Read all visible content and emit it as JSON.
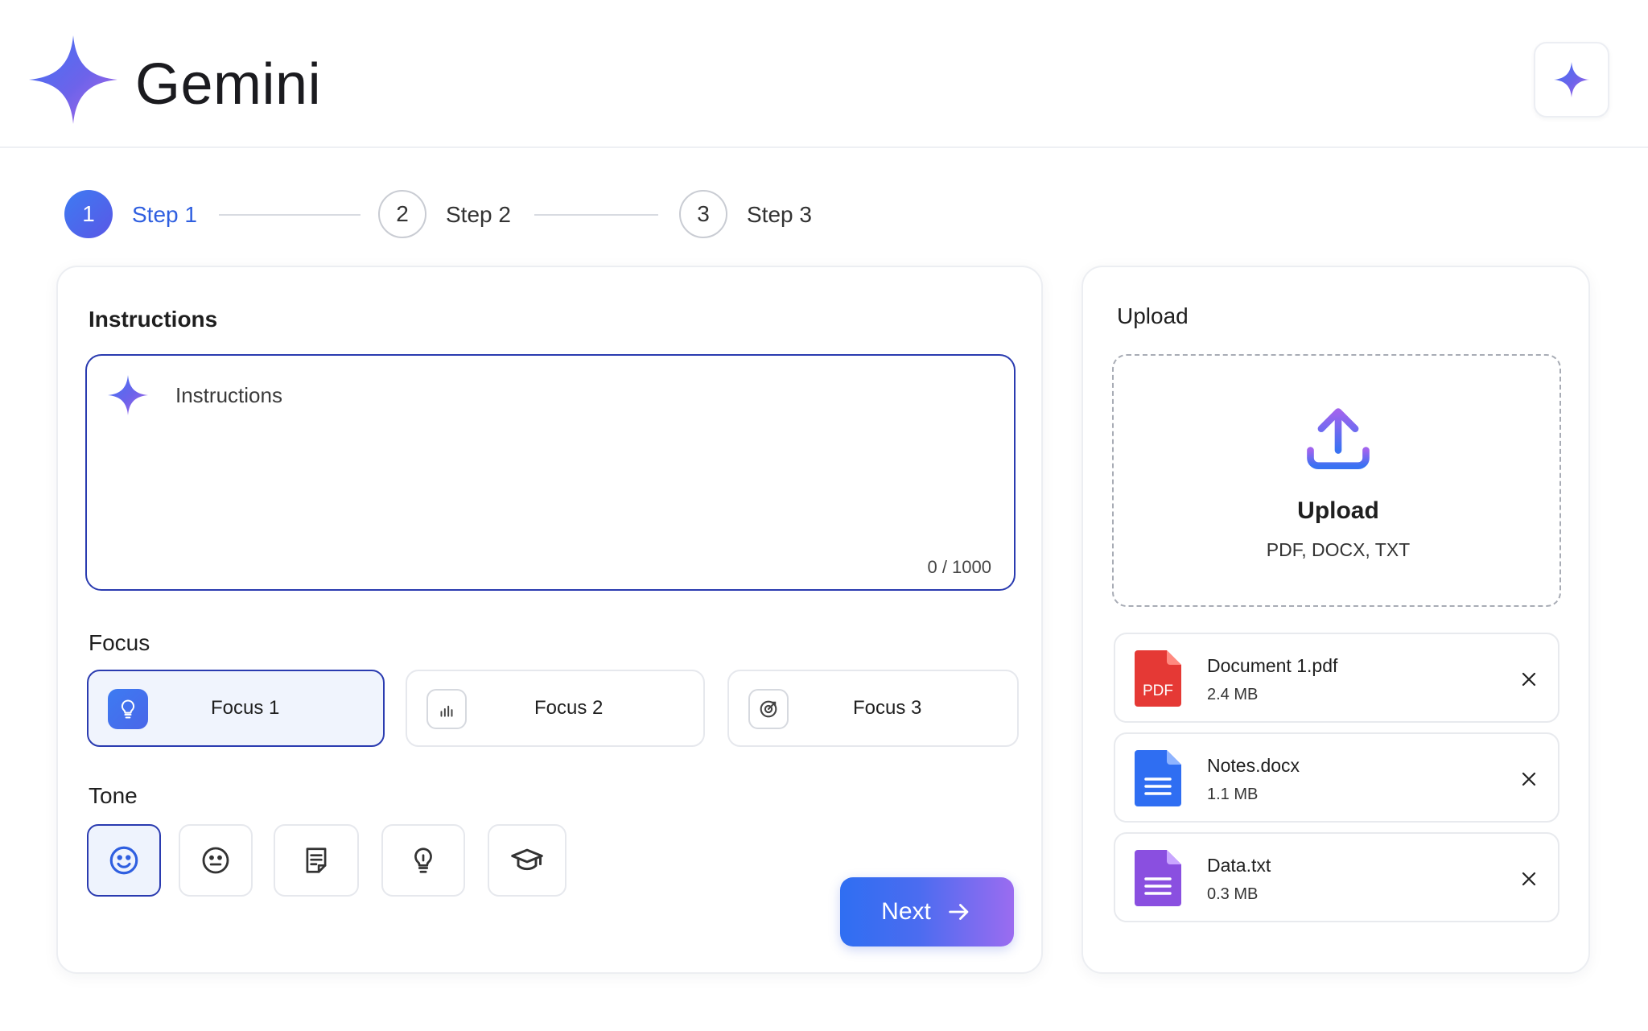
{
  "header": {
    "brand": "Gemini",
    "logo_icon": "gemini-sparkle-icon",
    "action_icon": "sparkle-icon"
  },
  "stepper": {
    "steps": [
      {
        "number": "1",
        "label": "Step 1",
        "active": true
      },
      {
        "number": "2",
        "label": "Step 2",
        "active": false
      },
      {
        "number": "3",
        "label": "Step 3",
        "active": false
      }
    ]
  },
  "instructions": {
    "section_title": "Instructions",
    "placeholder": "Instructions",
    "char_count": "0 / 1000"
  },
  "focus": {
    "section_title": "Focus",
    "options": [
      {
        "label": "Focus 1",
        "icon": "lightbulb-icon",
        "selected": true
      },
      {
        "label": "Focus 2",
        "icon": "bar-chart-icon",
        "selected": false
      },
      {
        "label": "Focus 3",
        "icon": "target-icon",
        "selected": false
      }
    ]
  },
  "tone": {
    "section_title": "Tone",
    "options": [
      {
        "icon": "smile-icon",
        "selected": true
      },
      {
        "icon": "neutral-face-icon",
        "selected": false
      },
      {
        "icon": "document-icon",
        "selected": false
      },
      {
        "icon": "lightbulb-icon",
        "selected": false
      },
      {
        "icon": "graduation-cap-icon",
        "selected": false
      }
    ]
  },
  "next_button": {
    "label": "Next",
    "icon": "arrow-right-icon"
  },
  "upload": {
    "section_title": "Upload",
    "drop_title": "Upload",
    "drop_formats": "PDF, DOCX, TXT",
    "drop_icon": "upload-icon",
    "files": [
      {
        "name": "Document 1.pdf",
        "size": "2.4 MB",
        "type": "pdf",
        "badge": "PDF",
        "color": "#e53935"
      },
      {
        "name": "Notes.docx",
        "size": "1.1 MB",
        "type": "docx",
        "color": "#2f6ef2"
      },
      {
        "name": "Data.txt",
        "size": "0.3 MB",
        "type": "txt",
        "color": "#8a4fe0"
      }
    ]
  },
  "colors": {
    "accent_blue": "#2f6ef2",
    "accent_purple": "#9b6cf0",
    "selected_border": "#2a3bb0"
  }
}
